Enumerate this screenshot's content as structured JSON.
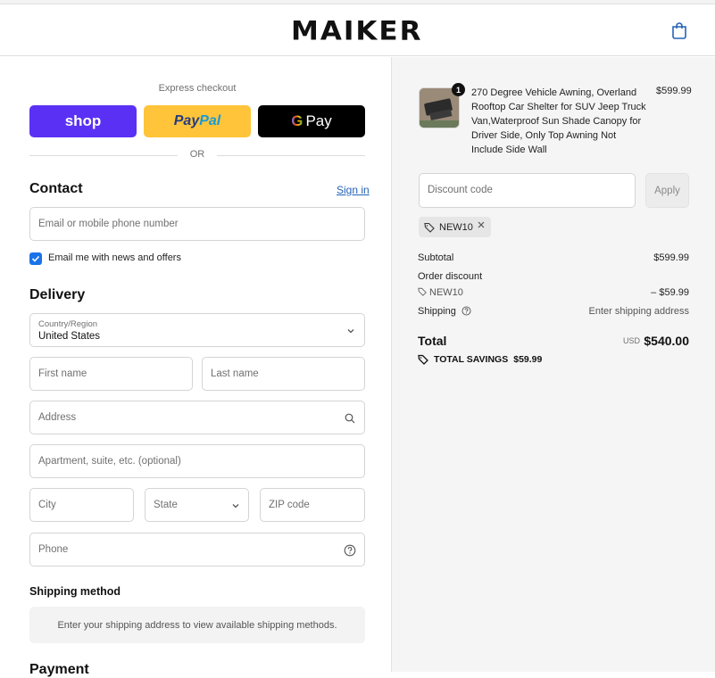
{
  "header": {
    "logo": "MAIKER",
    "cart_icon": "shopping-bag-icon"
  },
  "express": {
    "title": "Express checkout",
    "shop_label": "shop",
    "paypal_label_1": "Pay",
    "paypal_label_2": "Pal",
    "gpay_g": "G",
    "gpay_label": "Pay",
    "or": "OR"
  },
  "contact": {
    "heading": "Contact",
    "signin": "Sign in",
    "email_placeholder": "Email or mobile phone number",
    "newsletter_label": "Email me with news and offers",
    "newsletter_checked": true
  },
  "delivery": {
    "heading": "Delivery",
    "country_label": "Country/Region",
    "country_value": "United States",
    "first_name": "First name",
    "last_name": "Last name",
    "address": "Address",
    "apartment": "Apartment, suite, etc. (optional)",
    "city": "City",
    "state": "State",
    "zip": "ZIP code",
    "phone": "Phone"
  },
  "shipping_method": {
    "heading": "Shipping method",
    "message": "Enter your shipping address to view available shipping methods."
  },
  "payment": {
    "heading": "Payment"
  },
  "summary": {
    "product": {
      "quantity": "1",
      "name": "270 Degree Vehicle Awning, Overland Rooftop Car Shelter for SUV Jeep Truck Van,Waterproof Sun Shade Canopy for Driver Side, Only Top Awning Not Include Side Wall",
      "price": "$599.99"
    },
    "discount_placeholder": "Discount code",
    "apply": "Apply",
    "applied_code": "NEW10",
    "subtotal_label": "Subtotal",
    "subtotal_value": "$599.99",
    "order_discount_label": "Order discount",
    "discount_code": "NEW10",
    "discount_value": "– $59.99",
    "shipping_label": "Shipping",
    "shipping_value": "Enter shipping address",
    "total_label": "Total",
    "currency": "USD",
    "total_value": "$540.00",
    "savings_label": "TOTAL SAVINGS",
    "savings_value": "$59.99"
  },
  "colors": {
    "shop": "#5a31f4",
    "paypal": "#ffc439",
    "gpay": "#000000",
    "link": "#2563b6",
    "checkbox": "#1a73e8"
  }
}
